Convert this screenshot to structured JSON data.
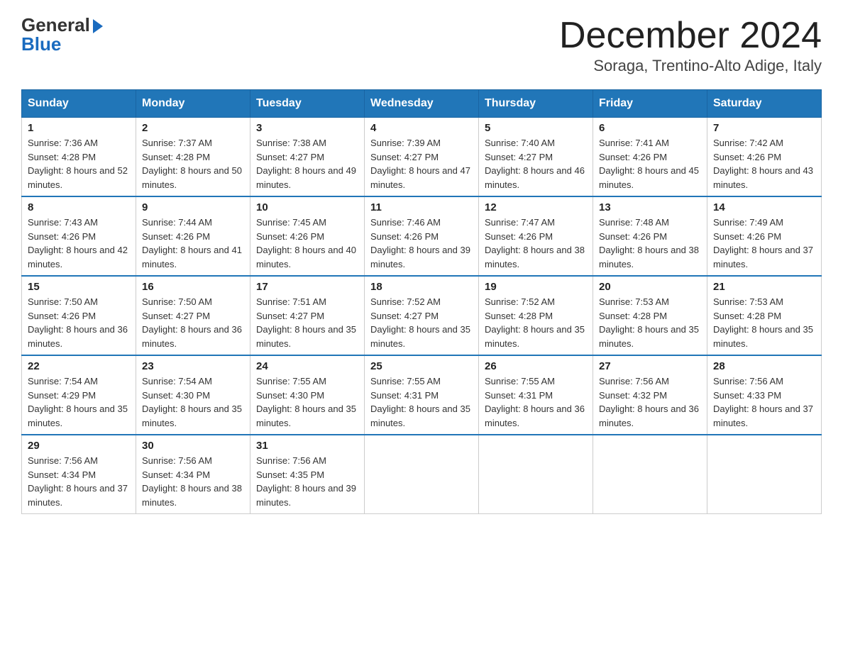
{
  "header": {
    "logo_general": "General",
    "logo_blue": "Blue",
    "month_year": "December 2024",
    "location": "Soraga, Trentino-Alto Adige, Italy"
  },
  "days_of_week": [
    "Sunday",
    "Monday",
    "Tuesday",
    "Wednesday",
    "Thursday",
    "Friday",
    "Saturday"
  ],
  "weeks": [
    [
      {
        "day": "1",
        "sunrise": "Sunrise: 7:36 AM",
        "sunset": "Sunset: 4:28 PM",
        "daylight": "Daylight: 8 hours and 52 minutes."
      },
      {
        "day": "2",
        "sunrise": "Sunrise: 7:37 AM",
        "sunset": "Sunset: 4:28 PM",
        "daylight": "Daylight: 8 hours and 50 minutes."
      },
      {
        "day": "3",
        "sunrise": "Sunrise: 7:38 AM",
        "sunset": "Sunset: 4:27 PM",
        "daylight": "Daylight: 8 hours and 49 minutes."
      },
      {
        "day": "4",
        "sunrise": "Sunrise: 7:39 AM",
        "sunset": "Sunset: 4:27 PM",
        "daylight": "Daylight: 8 hours and 47 minutes."
      },
      {
        "day": "5",
        "sunrise": "Sunrise: 7:40 AM",
        "sunset": "Sunset: 4:27 PM",
        "daylight": "Daylight: 8 hours and 46 minutes."
      },
      {
        "day": "6",
        "sunrise": "Sunrise: 7:41 AM",
        "sunset": "Sunset: 4:26 PM",
        "daylight": "Daylight: 8 hours and 45 minutes."
      },
      {
        "day": "7",
        "sunrise": "Sunrise: 7:42 AM",
        "sunset": "Sunset: 4:26 PM",
        "daylight": "Daylight: 8 hours and 43 minutes."
      }
    ],
    [
      {
        "day": "8",
        "sunrise": "Sunrise: 7:43 AM",
        "sunset": "Sunset: 4:26 PM",
        "daylight": "Daylight: 8 hours and 42 minutes."
      },
      {
        "day": "9",
        "sunrise": "Sunrise: 7:44 AM",
        "sunset": "Sunset: 4:26 PM",
        "daylight": "Daylight: 8 hours and 41 minutes."
      },
      {
        "day": "10",
        "sunrise": "Sunrise: 7:45 AM",
        "sunset": "Sunset: 4:26 PM",
        "daylight": "Daylight: 8 hours and 40 minutes."
      },
      {
        "day": "11",
        "sunrise": "Sunrise: 7:46 AM",
        "sunset": "Sunset: 4:26 PM",
        "daylight": "Daylight: 8 hours and 39 minutes."
      },
      {
        "day": "12",
        "sunrise": "Sunrise: 7:47 AM",
        "sunset": "Sunset: 4:26 PM",
        "daylight": "Daylight: 8 hours and 38 minutes."
      },
      {
        "day": "13",
        "sunrise": "Sunrise: 7:48 AM",
        "sunset": "Sunset: 4:26 PM",
        "daylight": "Daylight: 8 hours and 38 minutes."
      },
      {
        "day": "14",
        "sunrise": "Sunrise: 7:49 AM",
        "sunset": "Sunset: 4:26 PM",
        "daylight": "Daylight: 8 hours and 37 minutes."
      }
    ],
    [
      {
        "day": "15",
        "sunrise": "Sunrise: 7:50 AM",
        "sunset": "Sunset: 4:26 PM",
        "daylight": "Daylight: 8 hours and 36 minutes."
      },
      {
        "day": "16",
        "sunrise": "Sunrise: 7:50 AM",
        "sunset": "Sunset: 4:27 PM",
        "daylight": "Daylight: 8 hours and 36 minutes."
      },
      {
        "day": "17",
        "sunrise": "Sunrise: 7:51 AM",
        "sunset": "Sunset: 4:27 PM",
        "daylight": "Daylight: 8 hours and 35 minutes."
      },
      {
        "day": "18",
        "sunrise": "Sunrise: 7:52 AM",
        "sunset": "Sunset: 4:27 PM",
        "daylight": "Daylight: 8 hours and 35 minutes."
      },
      {
        "day": "19",
        "sunrise": "Sunrise: 7:52 AM",
        "sunset": "Sunset: 4:28 PM",
        "daylight": "Daylight: 8 hours and 35 minutes."
      },
      {
        "day": "20",
        "sunrise": "Sunrise: 7:53 AM",
        "sunset": "Sunset: 4:28 PM",
        "daylight": "Daylight: 8 hours and 35 minutes."
      },
      {
        "day": "21",
        "sunrise": "Sunrise: 7:53 AM",
        "sunset": "Sunset: 4:28 PM",
        "daylight": "Daylight: 8 hours and 35 minutes."
      }
    ],
    [
      {
        "day": "22",
        "sunrise": "Sunrise: 7:54 AM",
        "sunset": "Sunset: 4:29 PM",
        "daylight": "Daylight: 8 hours and 35 minutes."
      },
      {
        "day": "23",
        "sunrise": "Sunrise: 7:54 AM",
        "sunset": "Sunset: 4:30 PM",
        "daylight": "Daylight: 8 hours and 35 minutes."
      },
      {
        "day": "24",
        "sunrise": "Sunrise: 7:55 AM",
        "sunset": "Sunset: 4:30 PM",
        "daylight": "Daylight: 8 hours and 35 minutes."
      },
      {
        "day": "25",
        "sunrise": "Sunrise: 7:55 AM",
        "sunset": "Sunset: 4:31 PM",
        "daylight": "Daylight: 8 hours and 35 minutes."
      },
      {
        "day": "26",
        "sunrise": "Sunrise: 7:55 AM",
        "sunset": "Sunset: 4:31 PM",
        "daylight": "Daylight: 8 hours and 36 minutes."
      },
      {
        "day": "27",
        "sunrise": "Sunrise: 7:56 AM",
        "sunset": "Sunset: 4:32 PM",
        "daylight": "Daylight: 8 hours and 36 minutes."
      },
      {
        "day": "28",
        "sunrise": "Sunrise: 7:56 AM",
        "sunset": "Sunset: 4:33 PM",
        "daylight": "Daylight: 8 hours and 37 minutes."
      }
    ],
    [
      {
        "day": "29",
        "sunrise": "Sunrise: 7:56 AM",
        "sunset": "Sunset: 4:34 PM",
        "daylight": "Daylight: 8 hours and 37 minutes."
      },
      {
        "day": "30",
        "sunrise": "Sunrise: 7:56 AM",
        "sunset": "Sunset: 4:34 PM",
        "daylight": "Daylight: 8 hours and 38 minutes."
      },
      {
        "day": "31",
        "sunrise": "Sunrise: 7:56 AM",
        "sunset": "Sunset: 4:35 PM",
        "daylight": "Daylight: 8 hours and 39 minutes."
      },
      null,
      null,
      null,
      null
    ]
  ]
}
